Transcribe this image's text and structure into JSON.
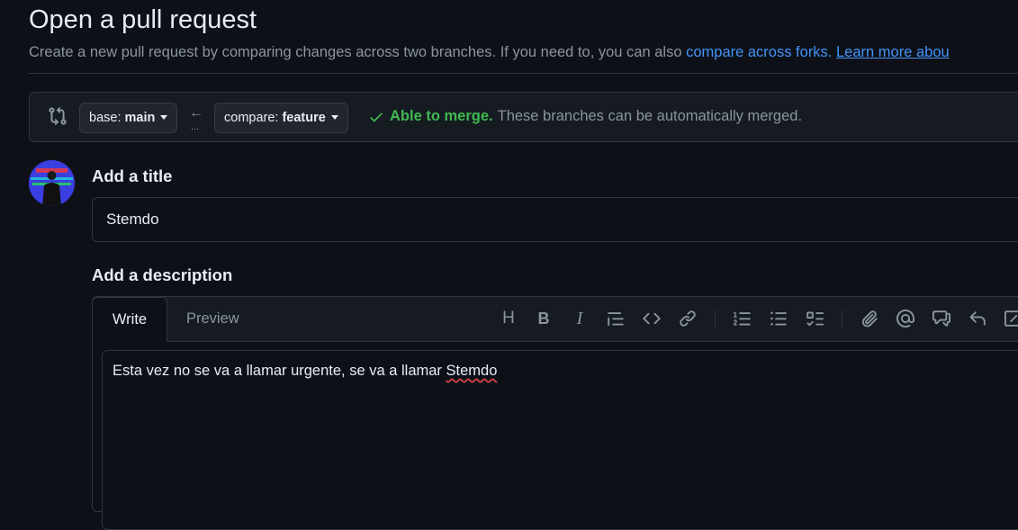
{
  "page": {
    "title": "Open a pull request",
    "subtitle_prefix": "Create a new pull request by comparing changes across two branches. If you need to, you can also ",
    "subtitle_link": "compare across forks.",
    "subtitle_learn": "Learn more abou"
  },
  "compare": {
    "base_prefix": "base:",
    "base_branch": "main",
    "compare_prefix": "compare:",
    "compare_branch": "feature",
    "arrow": "←",
    "dots": "...",
    "merge_ok": "Able to merge.",
    "merge_detail": "These branches can be automatically merged."
  },
  "form": {
    "title_label": "Add a title",
    "title_value": "Stemdo",
    "description_label": "Add a description"
  },
  "editor": {
    "tab_write": "Write",
    "tab_preview": "Preview",
    "heading_glyph": "H",
    "bold_glyph": "B",
    "italic_glyph": "I",
    "body_text_main": "Esta vez no se va a llamar urgente, se va a llamar ",
    "body_text_flagged": "Stemdo"
  },
  "icons": {
    "compare": "git-compare-icon",
    "check": "check-icon",
    "caret": "triangle-down-icon"
  },
  "colors": {
    "background": "#0d1117",
    "surface": "#161b22",
    "border": "#30363d",
    "link": "#4493f8",
    "success": "#3fb950",
    "muted": "#8b949e"
  }
}
